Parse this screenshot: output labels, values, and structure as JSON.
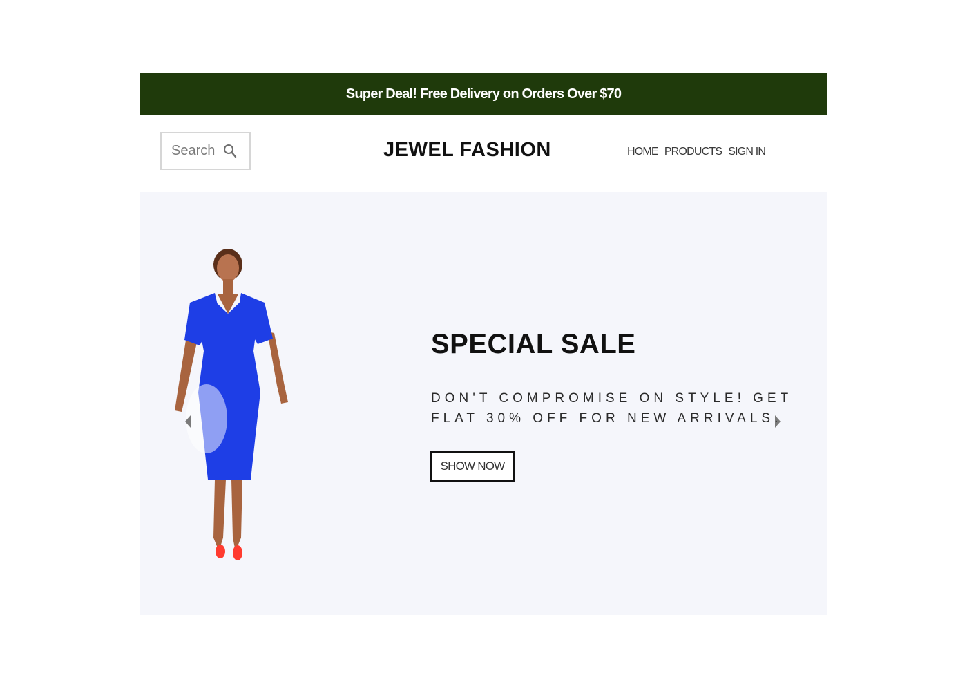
{
  "promo": {
    "text": "Super Deal! Free Delivery on Orders Over $70",
    "background": "#1f3a0b"
  },
  "header": {
    "search_placeholder": "Search",
    "search_icon": "search-icon",
    "logo": "JEWEL FASHION",
    "nav": [
      "HOME",
      "PRODUCTS",
      "SIGN IN"
    ]
  },
  "hero": {
    "title": "SPECIAL SALE",
    "subtitle": "DON'T COMPROMISE ON STYLE! GET FLAT 30% OFF FOR NEW ARRIVALS.",
    "button_label": "SHOW NOW",
    "image": "model-in-blue-dress",
    "dress_color": "#1e3ee6",
    "shoe_color": "#ff3b2f",
    "background": "#f5f6fb"
  },
  "slider": {
    "prev_icon": "chevron-left-icon",
    "next_icon": "chevron-right-icon"
  }
}
